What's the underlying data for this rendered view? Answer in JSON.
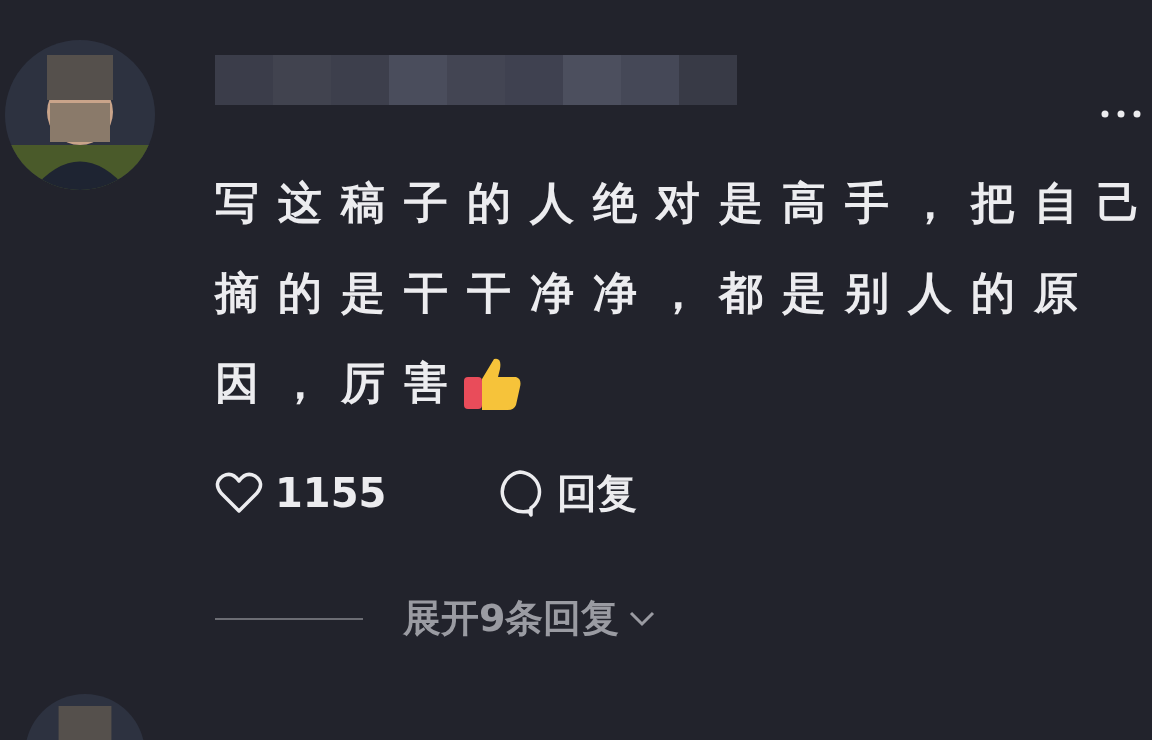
{
  "comment": {
    "text_lines": [
      "写这稿子的人绝对是高手，把自己",
      "摘的是干干净净，都是别人的原",
      "因，厉害"
    ],
    "likes": "1155",
    "reply_label": "回复"
  },
  "expand_replies": {
    "label": "展开9条回复"
  }
}
